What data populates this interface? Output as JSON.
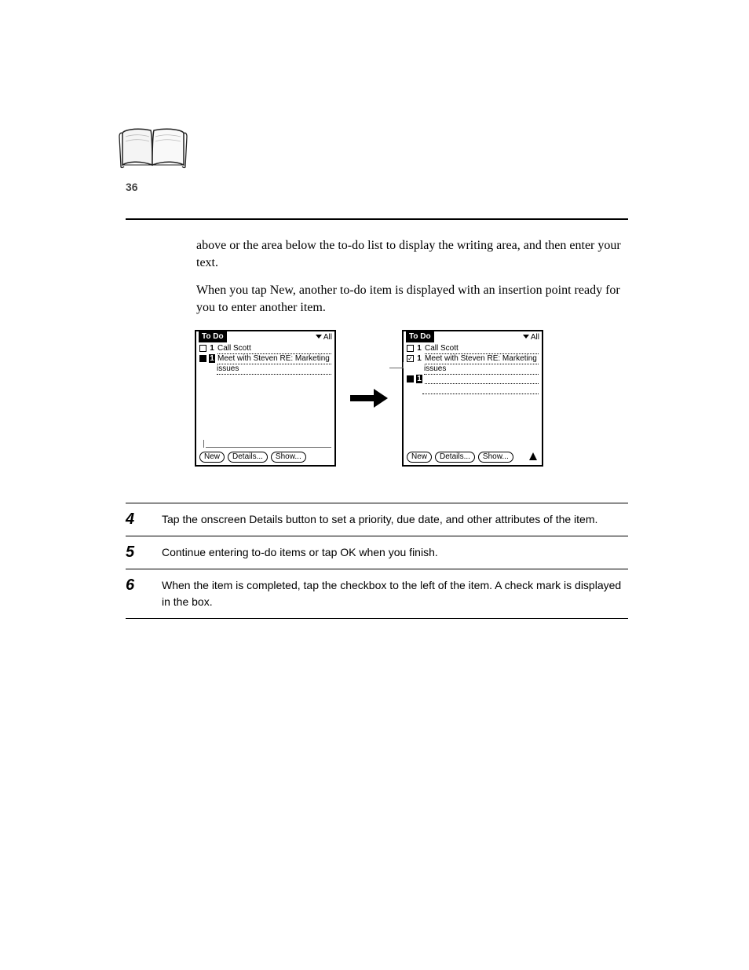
{
  "page_number": "36",
  "intro_paragraphs": [
    "above or the area below the to-do list to display the writing area, and then enter your text.",
    "When you tap New, another to-do item is displayed with an insertion point ready for you to enter another item."
  ],
  "screens": {
    "left": {
      "title": "To Do",
      "category": "All",
      "items": [
        {
          "checked": false,
          "filled": false,
          "priority": "1",
          "priority_inverted": false,
          "text": "Call Scott"
        },
        {
          "checked": false,
          "filled": true,
          "priority": "1",
          "priority_inverted": true,
          "text": "Meet with Steven RE: Marketing"
        }
      ],
      "second_line": "issues",
      "buttons": [
        "New",
        "Details...",
        "Show..."
      ]
    },
    "right": {
      "title": "To Do",
      "category": "All",
      "items": [
        {
          "checked": false,
          "filled": false,
          "priority": "1",
          "priority_inverted": false,
          "text": "Call Scott"
        },
        {
          "checked": true,
          "filled": false,
          "priority": "1",
          "priority_inverted": false,
          "text": "Meet with Steven RE: Marketing"
        }
      ],
      "second_line": "issues",
      "new_item": {
        "filled": true,
        "priority": "1",
        "priority_inverted": true
      },
      "buttons": [
        "New",
        "Details...",
        "Show..."
      ]
    }
  },
  "steps": [
    {
      "num": "4",
      "text": "Tap the onscreen Details button to set a priority, due date, and other attributes of the item."
    },
    {
      "num": "5",
      "text": "Continue entering to-do items or tap OK when you finish."
    },
    {
      "num": "6",
      "text": "When the item is completed, tap the checkbox to the left of the item. A check mark is displayed in the box."
    }
  ]
}
